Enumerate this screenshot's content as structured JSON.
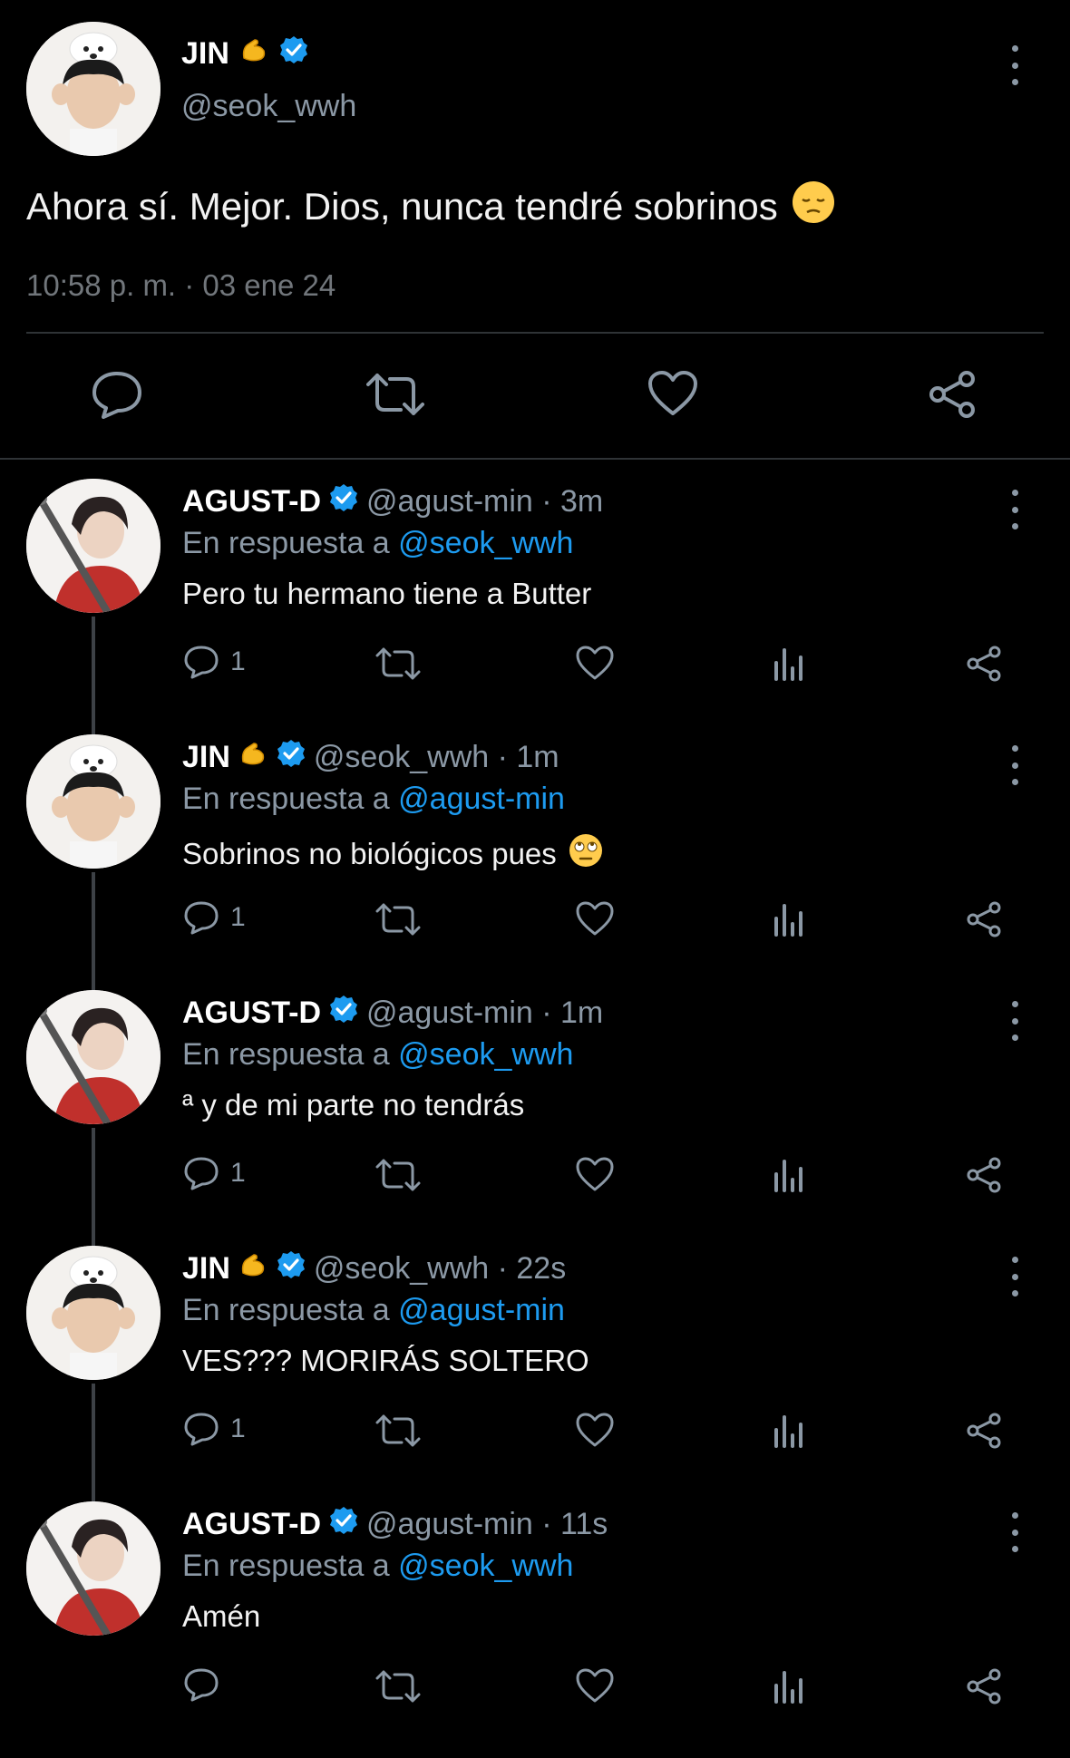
{
  "main_tweet": {
    "name": "JIN",
    "handle": "@seok_wwh",
    "text": "Ahora sí. Mejor. Dios, nunca tendré sobrinos",
    "timestamp": "10:58 p. m. · 03 ene 24",
    "name_emoji": "flexed-biceps-emoji",
    "text_emoji": "pensive-face-emoji"
  },
  "replies": [
    {
      "name": "AGUST-D",
      "handle": "@agust-min · 3m",
      "reply_prefix": "En respuesta a",
      "reply_to": "@seok_wwh",
      "text": "Pero tu hermano tiene a Butter",
      "reply_count": "1"
    },
    {
      "name": "JIN",
      "handle": "@seok_wwh · 1m",
      "reply_prefix": "En respuesta a",
      "reply_to": "@agust-min",
      "text": "Sobrinos no biológicos pues",
      "reply_count": "1"
    },
    {
      "name": "AGUST-D",
      "handle": "@agust-min · 1m",
      "reply_prefix": "En respuesta a",
      "reply_to": "@seok_wwh",
      "text": "ª y de mi parte no tendrás",
      "reply_count": "1"
    },
    {
      "name": "JIN",
      "handle": "@seok_wwh · 22s",
      "reply_prefix": "En respuesta a",
      "reply_to": "@agust-min",
      "text": "VES??? MORIRÁS SOLTERO",
      "reply_count": "1"
    },
    {
      "name": "AGUST-D",
      "handle": "@agust-min · 11s",
      "reply_prefix": "En respuesta a",
      "reply_to": "@seok_wwh",
      "text": "Amén",
      "reply_count": ""
    }
  ],
  "colors": {
    "background": "#000000",
    "text": "#e7e9ea",
    "muted": "#8b98a5",
    "link": "#1d9bf0",
    "verified": "#1d9bf0",
    "divider": "#2f3336"
  }
}
